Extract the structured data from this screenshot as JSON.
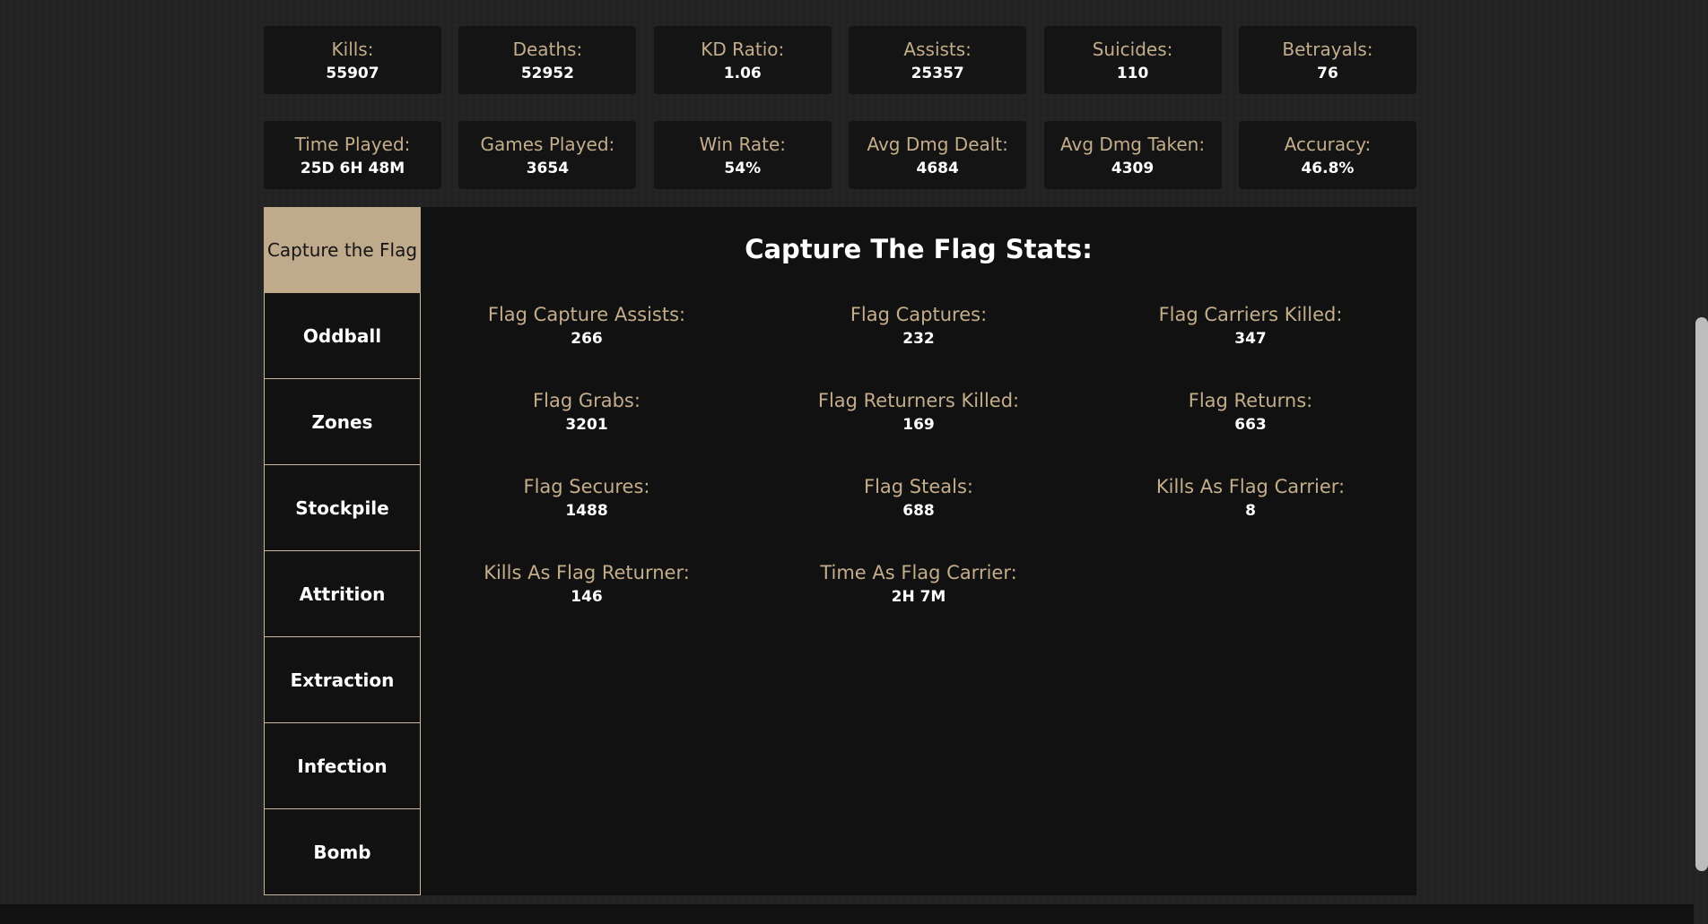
{
  "overview": {
    "row1": [
      {
        "label": "Kills:",
        "value": "55907"
      },
      {
        "label": "Deaths:",
        "value": "52952"
      },
      {
        "label": "KD Ratio:",
        "value": "1.06"
      },
      {
        "label": "Assists:",
        "value": "25357"
      },
      {
        "label": "Suicides:",
        "value": "110"
      },
      {
        "label": "Betrayals:",
        "value": "76"
      }
    ],
    "row2": [
      {
        "label": "Time Played:",
        "value": "25D 6H 48M"
      },
      {
        "label": "Games Played:",
        "value": "3654"
      },
      {
        "label": "Win Rate:",
        "value": "54%"
      },
      {
        "label": "Avg Dmg Dealt:",
        "value": "4684"
      },
      {
        "label": "Avg Dmg Taken:",
        "value": "4309"
      },
      {
        "label": "Accuracy:",
        "value": "46.8%"
      }
    ]
  },
  "modes": {
    "active": "Capture the Flag",
    "tabs": [
      "Capture the Flag",
      "Oddball",
      "Zones",
      "Stockpile",
      "Attrition",
      "Extraction",
      "Infection",
      "Bomb"
    ]
  },
  "panel": {
    "title": "Capture The Flag Stats:",
    "stats": [
      {
        "label": "Flag Capture Assists:",
        "value": "266"
      },
      {
        "label": "Flag Captures:",
        "value": "232"
      },
      {
        "label": "Flag Carriers Killed:",
        "value": "347"
      },
      {
        "label": "Flag Grabs:",
        "value": "3201"
      },
      {
        "label": "Flag Returners Killed:",
        "value": "169"
      },
      {
        "label": "Flag Returns:",
        "value": "663"
      },
      {
        "label": "Flag Secures:",
        "value": "1488"
      },
      {
        "label": "Flag Steals:",
        "value": "688"
      },
      {
        "label": "Kills As Flag Carrier:",
        "value": "8"
      },
      {
        "label": "Kills As Flag Returner:",
        "value": "146"
      },
      {
        "label": "Time As Flag Carrier:",
        "value": "2H 7M"
      }
    ]
  },
  "colors": {
    "accent": "#c4ad8a",
    "active_tab": "#bfab8c",
    "card_bg": "#141414",
    "page_bg": "#232323"
  }
}
